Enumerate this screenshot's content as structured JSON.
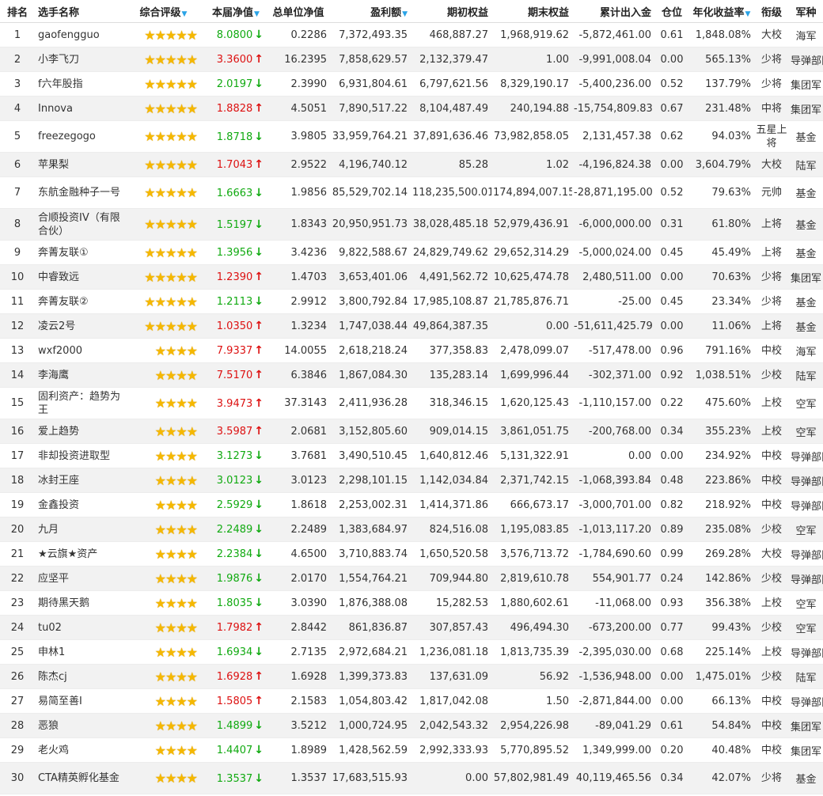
{
  "colors": {
    "up": "#dd1111",
    "down": "#11aa11",
    "star": "#f5b800",
    "sort_icon": "#2aa3e6"
  },
  "headers": {
    "rank": "排名",
    "name": "选手名称",
    "rating": "综合评级",
    "nav": "本届净值",
    "total_nav": "总单位净值",
    "profit": "盈利额",
    "begin_equity": "期初权益",
    "end_equity": "期末权益",
    "cum_flow": "累计出入金",
    "position": "仓位",
    "annual_return": "年化收益率",
    "rank_title": "衔级",
    "branch": "军种"
  },
  "rows": [
    {
      "rank": "1",
      "name": "gaofengguo",
      "stars": 5,
      "nav": "8.0800",
      "dir": "down",
      "total_nav": "0.2286",
      "profit": "7,372,493.35",
      "begin": "468,887.27",
      "end": "1,968,919.62",
      "flow": "-5,872,461.00",
      "pos": "0.61",
      "annual": "1,848.08%",
      "title": "大校",
      "branch": "海军"
    },
    {
      "rank": "2",
      "name": "小李飞刀",
      "stars": 5,
      "nav": "3.3600",
      "dir": "up",
      "total_nav": "16.2395",
      "profit": "7,858,629.57",
      "begin": "2,132,379.47",
      "end": "1.00",
      "flow": "-9,991,008.04",
      "pos": "0.00",
      "annual": "565.13%",
      "title": "少将",
      "branch": "导弹部队"
    },
    {
      "rank": "3",
      "name": "f六年股指",
      "stars": 5,
      "nav": "2.0197",
      "dir": "down",
      "total_nav": "2.3990",
      "profit": "6,931,804.61",
      "begin": "6,797,621.56",
      "end": "8,329,190.17",
      "flow": "-5,400,236.00",
      "pos": "0.52",
      "annual": "137.79%",
      "title": "少将",
      "branch": "集团军"
    },
    {
      "rank": "4",
      "name": "Innova",
      "stars": 5,
      "nav": "1.8828",
      "dir": "up",
      "total_nav": "4.5051",
      "profit": "7,890,517.22",
      "begin": "8,104,487.49",
      "end": "240,194.88",
      "flow": "-15,754,809.83",
      "pos": "0.67",
      "annual": "231.48%",
      "title": "中将",
      "branch": "集团军"
    },
    {
      "rank": "5",
      "name": "freezegogo",
      "stars": 5,
      "nav": "1.8718",
      "dir": "down",
      "total_nav": "3.9805",
      "profit": "33,959,764.21",
      "begin": "37,891,636.46",
      "end": "73,982,858.05",
      "flow": "2,131,457.38",
      "pos": "0.62",
      "annual": "94.03%",
      "title": "五星上将",
      "branch": "基金"
    },
    {
      "rank": "6",
      "name": "苹果梨",
      "stars": 5,
      "nav": "1.7043",
      "dir": "up",
      "total_nav": "2.9522",
      "profit": "4,196,740.12",
      "begin": "85.28",
      "end": "1.02",
      "flow": "-4,196,824.38",
      "pos": "0.00",
      "annual": "3,604.79%",
      "title": "大校",
      "branch": "陆军"
    },
    {
      "rank": "7",
      "name": "东航金融种子一号",
      "stars": 5,
      "nav": "1.6663",
      "dir": "down",
      "total_nav": "1.9856",
      "profit": "85,529,702.14",
      "begin": "118,235,500.01",
      "end": "174,894,007.15",
      "flow": "-28,871,195.00",
      "pos": "0.52",
      "annual": "79.63%",
      "title": "元帅",
      "branch": "基金"
    },
    {
      "rank": "8",
      "name": "合顺投资IV（有限合伙）",
      "stars": 5,
      "nav": "1.5197",
      "dir": "down",
      "total_nav": "1.8343",
      "profit": "20,950,951.73",
      "begin": "38,028,485.18",
      "end": "52,979,436.91",
      "flow": "-6,000,000.00",
      "pos": "0.31",
      "annual": "61.80%",
      "title": "上将",
      "branch": "基金"
    },
    {
      "rank": "9",
      "name": "奔菁友联①",
      "stars": 5,
      "nav": "1.3956",
      "dir": "down",
      "total_nav": "3.4236",
      "profit": "9,822,588.67",
      "begin": "24,829,749.62",
      "end": "29,652,314.29",
      "flow": "-5,000,024.00",
      "pos": "0.45",
      "annual": "45.49%",
      "title": "上将",
      "branch": "基金"
    },
    {
      "rank": "10",
      "name": "中睿致远",
      "stars": 5,
      "nav": "1.2390",
      "dir": "up",
      "total_nav": "1.4703",
      "profit": "3,653,401.06",
      "begin": "4,491,562.72",
      "end": "10,625,474.78",
      "flow": "2,480,511.00",
      "pos": "0.00",
      "annual": "70.63%",
      "title": "少将",
      "branch": "集团军"
    },
    {
      "rank": "11",
      "name": "奔菁友联②",
      "stars": 5,
      "nav": "1.2113",
      "dir": "down",
      "total_nav": "2.9912",
      "profit": "3,800,792.84",
      "begin": "17,985,108.87",
      "end": "21,785,876.71",
      "flow": "-25.00",
      "pos": "0.45",
      "annual": "23.34%",
      "title": "少将",
      "branch": "基金"
    },
    {
      "rank": "12",
      "name": "凌云2号",
      "stars": 5,
      "nav": "1.0350",
      "dir": "up",
      "total_nav": "1.3234",
      "profit": "1,747,038.44",
      "begin": "49,864,387.35",
      "end": "0.00",
      "flow": "-51,611,425.79",
      "pos": "0.00",
      "annual": "11.06%",
      "title": "上将",
      "branch": "基金"
    },
    {
      "rank": "13",
      "name": "wxf2000",
      "stars": 4,
      "nav": "7.9337",
      "dir": "up",
      "total_nav": "14.0055",
      "profit": "2,618,218.24",
      "begin": "377,358.83",
      "end": "2,478,099.07",
      "flow": "-517,478.00",
      "pos": "0.96",
      "annual": "791.16%",
      "title": "中校",
      "branch": "海军"
    },
    {
      "rank": "14",
      "name": "李海鹰",
      "stars": 4,
      "nav": "7.5170",
      "dir": "up",
      "total_nav": "6.3846",
      "profit": "1,867,084.30",
      "begin": "135,283.14",
      "end": "1,699,996.44",
      "flow": "-302,371.00",
      "pos": "0.92",
      "annual": "1,038.51%",
      "title": "少校",
      "branch": "陆军"
    },
    {
      "rank": "15",
      "name": "固利资产：趋势为王",
      "stars": 4,
      "nav": "3.9473",
      "dir": "up",
      "total_nav": "37.3143",
      "profit": "2,411,936.28",
      "begin": "318,346.15",
      "end": "1,620,125.43",
      "flow": "-1,110,157.00",
      "pos": "0.22",
      "annual": "475.60%",
      "title": "上校",
      "branch": "空军"
    },
    {
      "rank": "16",
      "name": "爱上趋势",
      "stars": 4,
      "nav": "3.5987",
      "dir": "up",
      "total_nav": "2.0681",
      "profit": "3,152,805.60",
      "begin": "909,014.15",
      "end": "3,861,051.75",
      "flow": "-200,768.00",
      "pos": "0.34",
      "annual": "355.23%",
      "title": "上校",
      "branch": "空军"
    },
    {
      "rank": "17",
      "name": "非却投资进取型",
      "stars": 4,
      "nav": "3.1273",
      "dir": "down",
      "total_nav": "3.7681",
      "profit": "3,490,510.45",
      "begin": "1,640,812.46",
      "end": "5,131,322.91",
      "flow": "0.00",
      "pos": "0.00",
      "annual": "234.92%",
      "title": "中校",
      "branch": "导弹部队"
    },
    {
      "rank": "18",
      "name": "冰封王座",
      "stars": 4,
      "nav": "3.0123",
      "dir": "down",
      "total_nav": "3.0123",
      "profit": "2,298,101.15",
      "begin": "1,142,034.84",
      "end": "2,371,742.15",
      "flow": "-1,068,393.84",
      "pos": "0.48",
      "annual": "223.86%",
      "title": "中校",
      "branch": "导弹部队"
    },
    {
      "rank": "19",
      "name": "金鑫投资",
      "stars": 4,
      "nav": "2.5929",
      "dir": "down",
      "total_nav": "1.8618",
      "profit": "2,253,002.31",
      "begin": "1,414,371.86",
      "end": "666,673.17",
      "flow": "-3,000,701.00",
      "pos": "0.82",
      "annual": "218.92%",
      "title": "中校",
      "branch": "导弹部队"
    },
    {
      "rank": "20",
      "name": "九月",
      "stars": 4,
      "nav": "2.2489",
      "dir": "down",
      "total_nav": "2.2489",
      "profit": "1,383,684.97",
      "begin": "824,516.08",
      "end": "1,195,083.85",
      "flow": "-1,013,117.20",
      "pos": "0.89",
      "annual": "235.08%",
      "title": "少校",
      "branch": "空军"
    },
    {
      "rank": "21",
      "name": "★云旗★资产",
      "stars": 4,
      "nav": "2.2384",
      "dir": "down",
      "total_nav": "4.6500",
      "profit": "3,710,883.74",
      "begin": "1,650,520.58",
      "end": "3,576,713.72",
      "flow": "-1,784,690.60",
      "pos": "0.99",
      "annual": "269.28%",
      "title": "大校",
      "branch": "导弹部队"
    },
    {
      "rank": "22",
      "name": "应坚平",
      "stars": 4,
      "nav": "1.9876",
      "dir": "down",
      "total_nav": "2.0170",
      "profit": "1,554,764.21",
      "begin": "709,944.80",
      "end": "2,819,610.78",
      "flow": "554,901.77",
      "pos": "0.24",
      "annual": "142.86%",
      "title": "少校",
      "branch": "导弹部队"
    },
    {
      "rank": "23",
      "name": "期待黑天鹅",
      "stars": 4,
      "nav": "1.8035",
      "dir": "down",
      "total_nav": "3.0390",
      "profit": "1,876,388.08",
      "begin": "15,282.53",
      "end": "1,880,602.61",
      "flow": "-11,068.00",
      "pos": "0.93",
      "annual": "356.38%",
      "title": "上校",
      "branch": "空军"
    },
    {
      "rank": "24",
      "name": "tu02",
      "stars": 4,
      "nav": "1.7982",
      "dir": "up",
      "total_nav": "2.8442",
      "profit": "861,836.87",
      "begin": "307,857.43",
      "end": "496,494.30",
      "flow": "-673,200.00",
      "pos": "0.77",
      "annual": "99.43%",
      "title": "少校",
      "branch": "空军"
    },
    {
      "rank": "25",
      "name": "申林1",
      "stars": 4,
      "nav": "1.6934",
      "dir": "down",
      "total_nav": "2.7135",
      "profit": "2,972,684.21",
      "begin": "1,236,081.18",
      "end": "1,813,735.39",
      "flow": "-2,395,030.00",
      "pos": "0.68",
      "annual": "225.14%",
      "title": "上校",
      "branch": "导弹部队"
    },
    {
      "rank": "26",
      "name": "陈杰cj",
      "stars": 4,
      "nav": "1.6928",
      "dir": "up",
      "total_nav": "1.6928",
      "profit": "1,399,373.83",
      "begin": "137,631.09",
      "end": "56.92",
      "flow": "-1,536,948.00",
      "pos": "0.00",
      "annual": "1,475.01%",
      "title": "少校",
      "branch": "陆军"
    },
    {
      "rank": "27",
      "name": "易简至善I",
      "stars": 4,
      "nav": "1.5805",
      "dir": "up",
      "total_nav": "2.1583",
      "profit": "1,054,803.42",
      "begin": "1,817,042.08",
      "end": "1.50",
      "flow": "-2,871,844.00",
      "pos": "0.00",
      "annual": "66.13%",
      "title": "中校",
      "branch": "导弹部队"
    },
    {
      "rank": "28",
      "name": "恶狼",
      "stars": 4,
      "nav": "1.4899",
      "dir": "down",
      "total_nav": "3.5212",
      "profit": "1,000,724.95",
      "begin": "2,042,543.32",
      "end": "2,954,226.98",
      "flow": "-89,041.29",
      "pos": "0.61",
      "annual": "54.84%",
      "title": "中校",
      "branch": "集团军"
    },
    {
      "rank": "29",
      "name": "老火鸡",
      "stars": 4,
      "nav": "1.4407",
      "dir": "down",
      "total_nav": "1.8989",
      "profit": "1,428,562.59",
      "begin": "2,992,333.93",
      "end": "5,770,895.52",
      "flow": "1,349,999.00",
      "pos": "0.20",
      "annual": "40.48%",
      "title": "中校",
      "branch": "集团军"
    },
    {
      "rank": "30",
      "name": "CTA精英孵化基金",
      "stars": 4,
      "nav": "1.3537",
      "dir": "down",
      "total_nav": "1.3537",
      "profit": "17,683,515.93",
      "begin": "0.00",
      "end": "57,802,981.49",
      "flow": "40,119,465.56",
      "pos": "0.34",
      "annual": "42.07%",
      "title": "少将",
      "branch": "基金"
    }
  ]
}
